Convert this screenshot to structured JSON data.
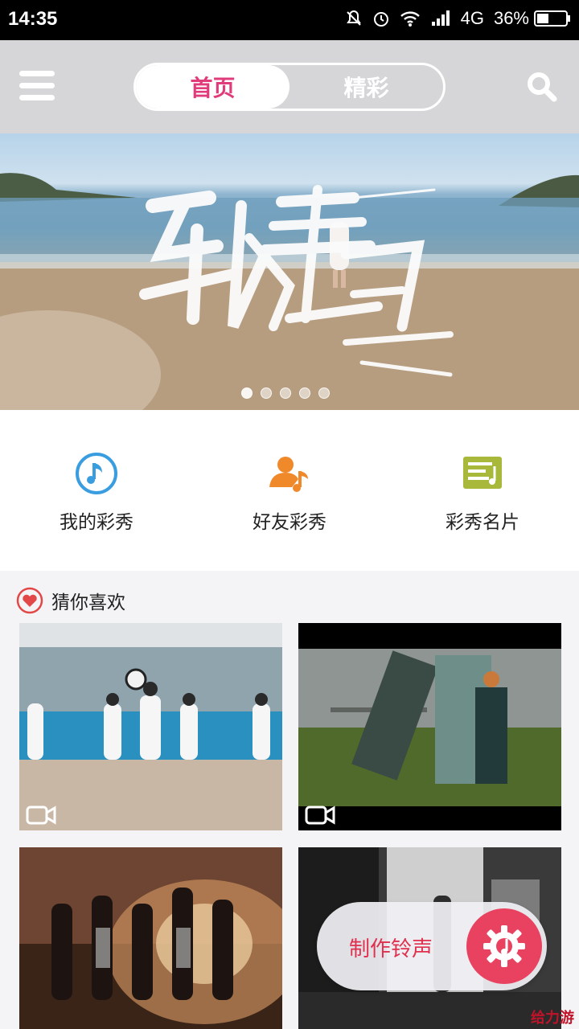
{
  "status_bar": {
    "time": "14:35",
    "network": "4G",
    "battery": "36%"
  },
  "header": {
    "tabs": [
      {
        "label": "首页",
        "active": true
      },
      {
        "label": "精彩",
        "active": false
      }
    ],
    "accent_color": "#e03c7c"
  },
  "banner": {
    "slides": 5,
    "active_slide": 1
  },
  "quick_actions": [
    {
      "label": "我的彩秀",
      "icon": "music-note-icon",
      "color": "#3a9de0"
    },
    {
      "label": "好友彩秀",
      "icon": "friend-music-icon",
      "color": "#f0892a"
    },
    {
      "label": "彩秀名片",
      "icon": "music-card-icon",
      "color": "#a8b83a"
    }
  ],
  "recommend": {
    "title": "猜你喜欢",
    "icon": "heart-icon"
  },
  "fab": {
    "label": "制作铃声",
    "icon": "gear-music-icon",
    "color": "#e94260"
  },
  "watermark": "给力游"
}
